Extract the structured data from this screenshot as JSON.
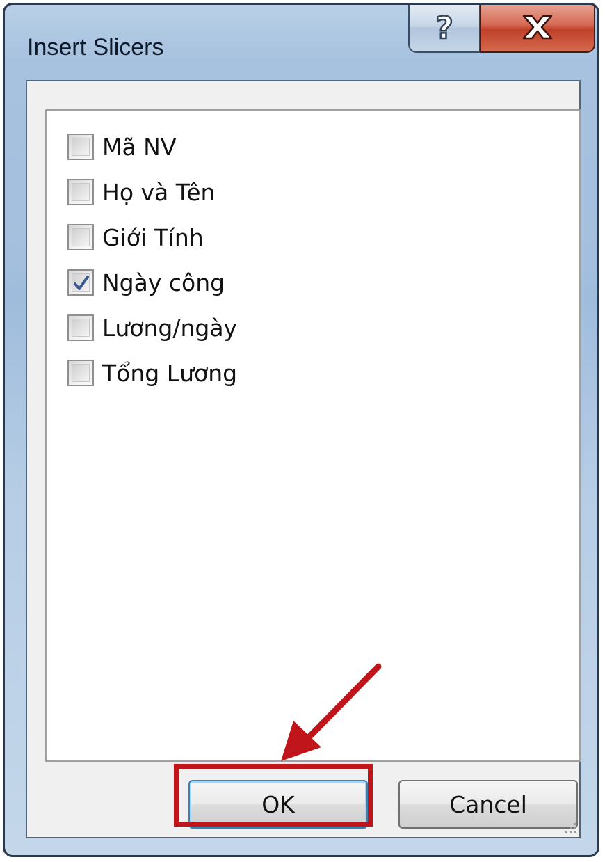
{
  "window": {
    "title": "Insert Slicers",
    "help_label": "?",
    "close_label": "✕"
  },
  "fields": [
    {
      "label": "Mã NV",
      "checked": false
    },
    {
      "label": "Họ và Tên",
      "checked": false
    },
    {
      "label": "Giới Tính",
      "checked": false
    },
    {
      "label": "Ngày công",
      "checked": true
    },
    {
      "label": "Lương/ngày",
      "checked": false
    },
    {
      "label": "Tổng Lương",
      "checked": false
    }
  ],
  "buttons": {
    "ok_label": "OK",
    "cancel_label": "Cancel"
  },
  "annotation": {
    "color": "#c0161b"
  },
  "icons": {
    "help": "question-mark-icon",
    "close": "close-x-icon",
    "check": "checkmark-icon",
    "arrow": "pointer-arrow-icon",
    "grip": "resize-grip-icon"
  }
}
